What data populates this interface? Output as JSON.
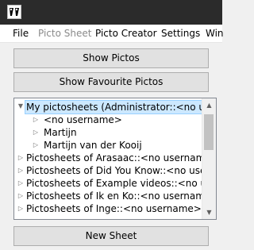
{
  "menu": {
    "items": [
      {
        "label": "File",
        "enabled": true
      },
      {
        "label": "Picto Sheet",
        "enabled": false
      },
      {
        "label": "Picto Creator",
        "enabled": true
      },
      {
        "label": "Settings",
        "enabled": true
      },
      {
        "label": "Win",
        "enabled": true
      }
    ]
  },
  "buttons": {
    "show_pictos": "Show Pictos",
    "show_favourites": "Show Favourite Pictos",
    "new_sheet": "New Sheet"
  },
  "tree": {
    "rows": [
      {
        "label": "My pictosheets (Administrator::<no username>)",
        "level": 0,
        "expanded": true,
        "selected": true
      },
      {
        "label": "<no username>",
        "level": 1,
        "expanded": false,
        "selected": false
      },
      {
        "label": "Martijn",
        "level": 1,
        "expanded": false,
        "selected": false
      },
      {
        "label": "Martijn van der Kooij",
        "level": 1,
        "expanded": false,
        "selected": false
      },
      {
        "label": "Pictosheets of Arasaac::<no username>",
        "level": 0,
        "expanded": false,
        "selected": false
      },
      {
        "label": "Pictosheets of Did You Know::<no username>",
        "level": 0,
        "expanded": false,
        "selected": false
      },
      {
        "label": "Pictosheets of Example videos::<no username>",
        "level": 0,
        "expanded": false,
        "selected": false
      },
      {
        "label": "Pictosheets of Ik en Ko::<no username>",
        "level": 0,
        "expanded": false,
        "selected": false
      },
      {
        "label": "Pictosheets of Inge::<no username>",
        "level": 0,
        "expanded": false,
        "selected": false
      }
    ]
  },
  "icons": {
    "app": "picto-app-icon",
    "collapsed": "chevron-right-icon",
    "expanded": "chevron-down-icon"
  }
}
